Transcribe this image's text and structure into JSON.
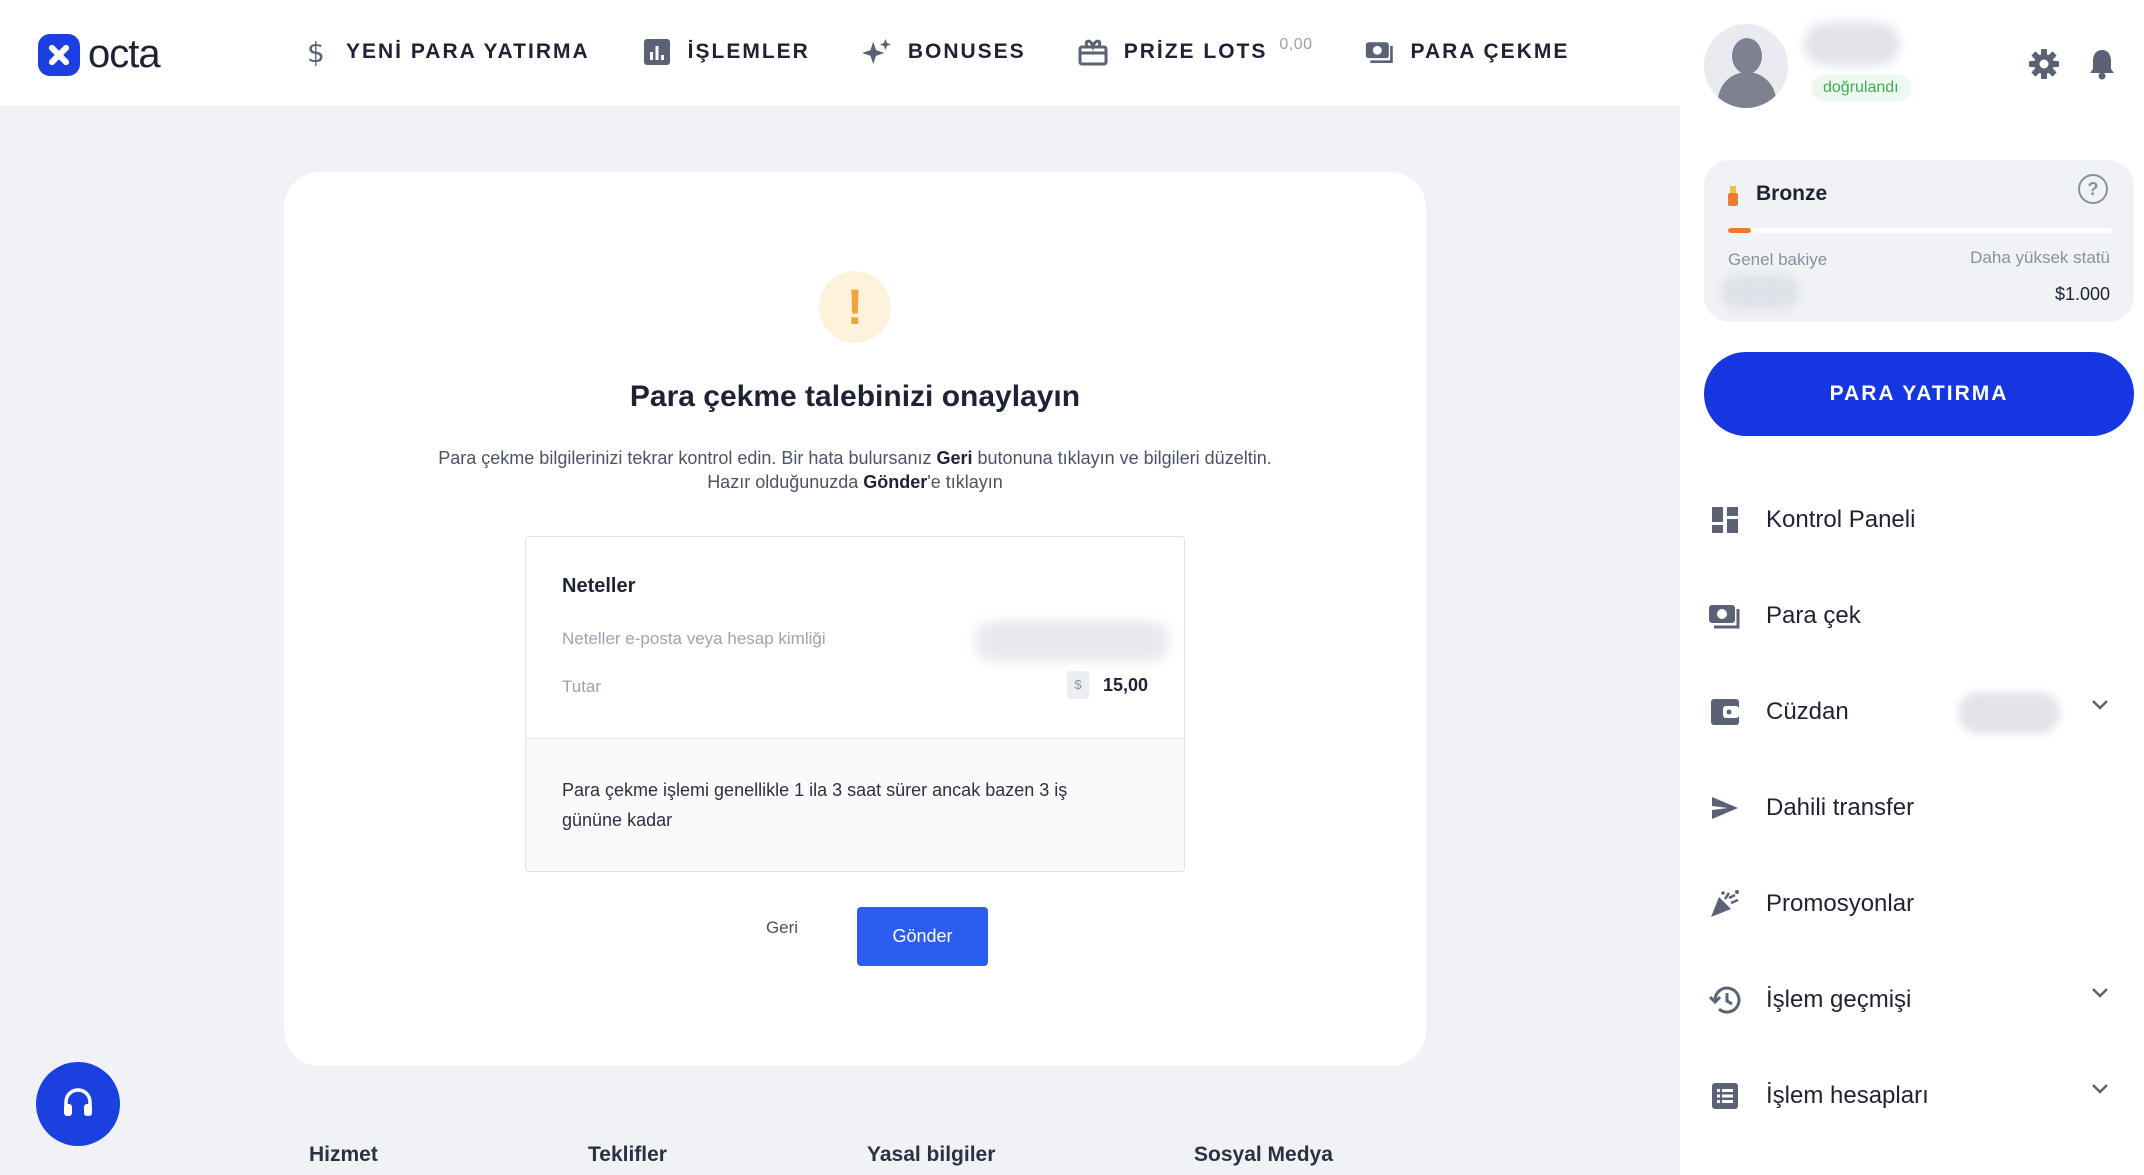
{
  "brand": {
    "logo_text": "octa"
  },
  "nav": {
    "items": [
      {
        "label": "YENİ PARA YATIRMA",
        "icon": "dollar-icon"
      },
      {
        "label": "İŞLEMLER",
        "icon": "bar-chart-icon"
      },
      {
        "label": "BONUSES",
        "icon": "sparkle-icon"
      },
      {
        "label": "PRİZE LOTS",
        "icon": "gift-box-icon",
        "badge": "0,00"
      },
      {
        "label": "PARA ÇEKME",
        "icon": "cash-icon"
      }
    ]
  },
  "confirm": {
    "title": "Para çekme talebinizi onaylayın",
    "desc_1": "Para çekme bilgilerinizi tekrar kontrol edin. Bir hata bulursanız ",
    "desc_geri": "Geri",
    "desc_2": " butonuna tıklayın ve bilgileri düzeltin.",
    "desc_3": "Hazır olduğunuzda ",
    "desc_gonder": "Gönder",
    "desc_4": "'e tıklayın",
    "method": "Neteller",
    "account_label": "Neteller e-posta veya hesap kimliği",
    "amount_label": "Tutar",
    "currency_symbol": "$",
    "amount_value": "15,00",
    "note": "Para çekme işlemi genellikle 1 ila 3 saat sürer ancak bazen 3 iş gününe kadar",
    "back_label": "Geri",
    "submit_label": "Gönder"
  },
  "footer": {
    "columns": [
      "Hizmet",
      "Teklifler",
      "Yasal bilgiler",
      "Sosyal Medya"
    ]
  },
  "sidebar": {
    "verified_label": "doğrulandı",
    "status": {
      "tier": "Bronze",
      "progress": 0.06,
      "left_label": "Genel bakiye",
      "right_label": "Daha yüksek statü",
      "right_value": "$1.000"
    },
    "deposit_label": "PARA YATIRMA",
    "menu": [
      {
        "label": "Kontrol Paneli",
        "icon": "dashboard-icon"
      },
      {
        "label": "Para çek",
        "icon": "cash-icon"
      },
      {
        "label": "Cüzdan",
        "icon": "wallet-icon"
      },
      {
        "label": "Dahili transfer",
        "icon": "send-icon"
      },
      {
        "label": "Promosyonlar",
        "icon": "party-popper-icon"
      },
      {
        "label": "İşlem geçmişi",
        "icon": "history-icon"
      },
      {
        "label": "İşlem hesapları",
        "icon": "list-icon"
      }
    ]
  },
  "colors": {
    "brand_blue": "#1536e0",
    "button_blue": "#2d5cf0",
    "warning": "#f0a43c",
    "verified_green": "#3faa58",
    "bronze": "#f07a2c"
  }
}
